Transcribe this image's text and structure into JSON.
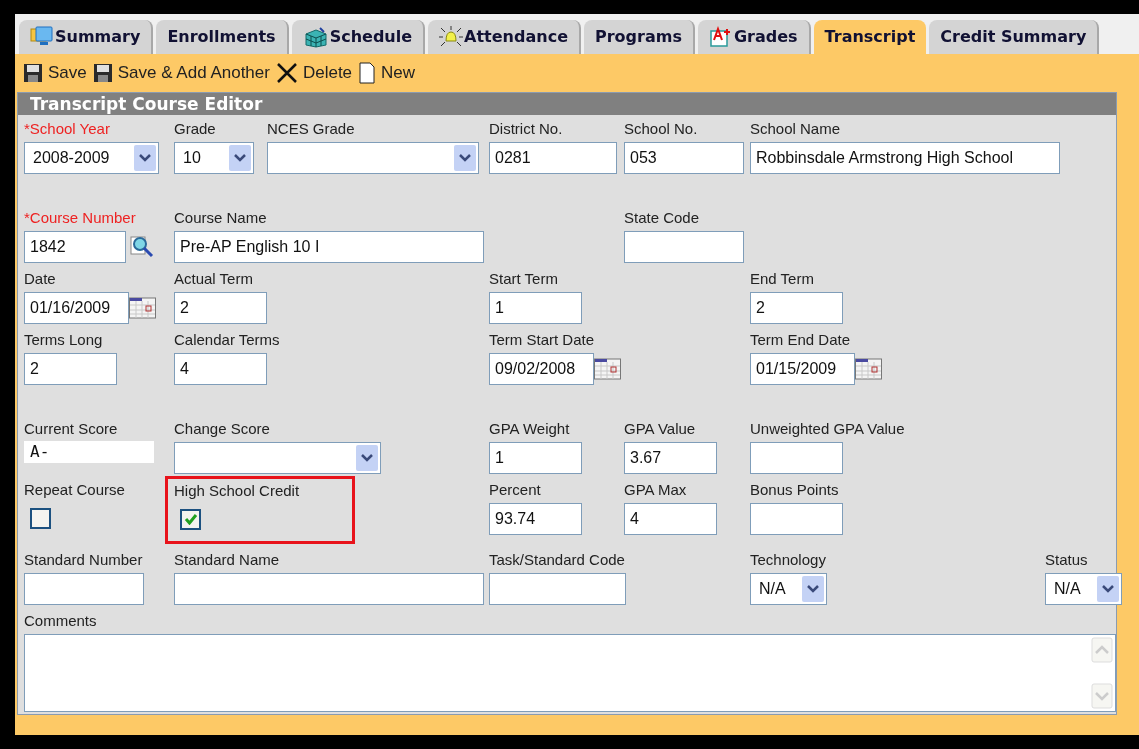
{
  "tabs": [
    {
      "label": "Summary",
      "selected": false
    },
    {
      "label": "Enrollments",
      "selected": false
    },
    {
      "label": "Schedule",
      "selected": false
    },
    {
      "label": "Attendance",
      "selected": false
    },
    {
      "label": "Programs",
      "selected": false
    },
    {
      "label": "Grades",
      "selected": false
    },
    {
      "label": "Transcript",
      "selected": true
    },
    {
      "label": "Credit Summary",
      "selected": false
    }
  ],
  "toolbar": [
    "Save",
    "Save & Add Another",
    "Delete",
    "New"
  ],
  "panel": {
    "title": "Transcript Course Editor",
    "lines": [
      {
        "fields": [
          {
            "label": "*School Year",
            "required": true,
            "kind": "select",
            "value": "2008-2009"
          },
          {
            "label": "Grade",
            "kind": "select",
            "value": "10"
          },
          {
            "label": "NCES Grade",
            "kind": "select"
          },
          {
            "label": "District No.",
            "kind": "text",
            "value": "0281"
          },
          {
            "label": "School No.",
            "kind": "text",
            "value": "053"
          },
          {
            "label": "School Name",
            "kind": "text",
            "value": "Robbinsdale Armstrong High School"
          }
        ]
      },
      {
        "fields": [
          {
            "label": "*Course Number",
            "required": true,
            "kind": "lookup",
            "value": "1842"
          },
          {
            "label": "Course Name",
            "kind": "text",
            "value": "Pre-AP English 10 I"
          },
          {
            "label": "State Code",
            "kind": "text"
          }
        ]
      },
      {
        "fields": [
          {
            "label": "Date",
            "kind": "date",
            "value": "01/16/2009"
          },
          {
            "label": "Actual Term",
            "kind": "text",
            "value": "2"
          },
          {
            "label": "Start Term",
            "kind": "text",
            "value": "1"
          },
          {
            "label": "End Term",
            "kind": "text",
            "value": "2"
          }
        ]
      },
      {
        "fields": [
          {
            "label": "Terms Long",
            "kind": "text",
            "value": "2"
          },
          {
            "label": "Calendar Terms",
            "kind": "text",
            "value": "4"
          },
          {
            "label": "Term Start Date",
            "kind": "date",
            "value": "09/02/2008"
          },
          {
            "label": "Term End Date",
            "kind": "date",
            "value": "01/15/2009"
          }
        ]
      },
      {
        "fields": [
          {
            "label": "Current Score",
            "kind": "display",
            "value": "A-"
          },
          {
            "label": "Change Score",
            "kind": "select"
          },
          {
            "label": "GPA Weight",
            "kind": "text",
            "value": "1"
          },
          {
            "label": "GPA Value",
            "kind": "text",
            "value": "3.67"
          },
          {
            "label": "Unweighted GPA Value",
            "kind": "text"
          }
        ]
      },
      {
        "fields": [
          {
            "label": "Repeat Course",
            "kind": "checkbox",
            "checked": false
          },
          {
            "label": "High School Credit",
            "kind": "checkbox",
            "checked": true,
            "highlighted": true
          },
          {
            "label": "Percent",
            "kind": "text",
            "value": "93.74"
          },
          {
            "label": "GPA Max",
            "kind": "text",
            "value": "4"
          },
          {
            "label": "Bonus Points",
            "kind": "text"
          }
        ]
      },
      {
        "fields": [
          {
            "label": "Standard Number",
            "kind": "text"
          },
          {
            "label": "Standard Name",
            "kind": "text"
          },
          {
            "label": "Task/Standard Code",
            "kind": "text"
          },
          {
            "label": "Technology",
            "kind": "select",
            "value": "N/A"
          },
          {
            "label": "Status",
            "kind": "select",
            "value": "N/A"
          }
        ]
      },
      {
        "fields": [
          {
            "label": "Comments",
            "kind": "textarea"
          }
        ]
      }
    ]
  }
}
